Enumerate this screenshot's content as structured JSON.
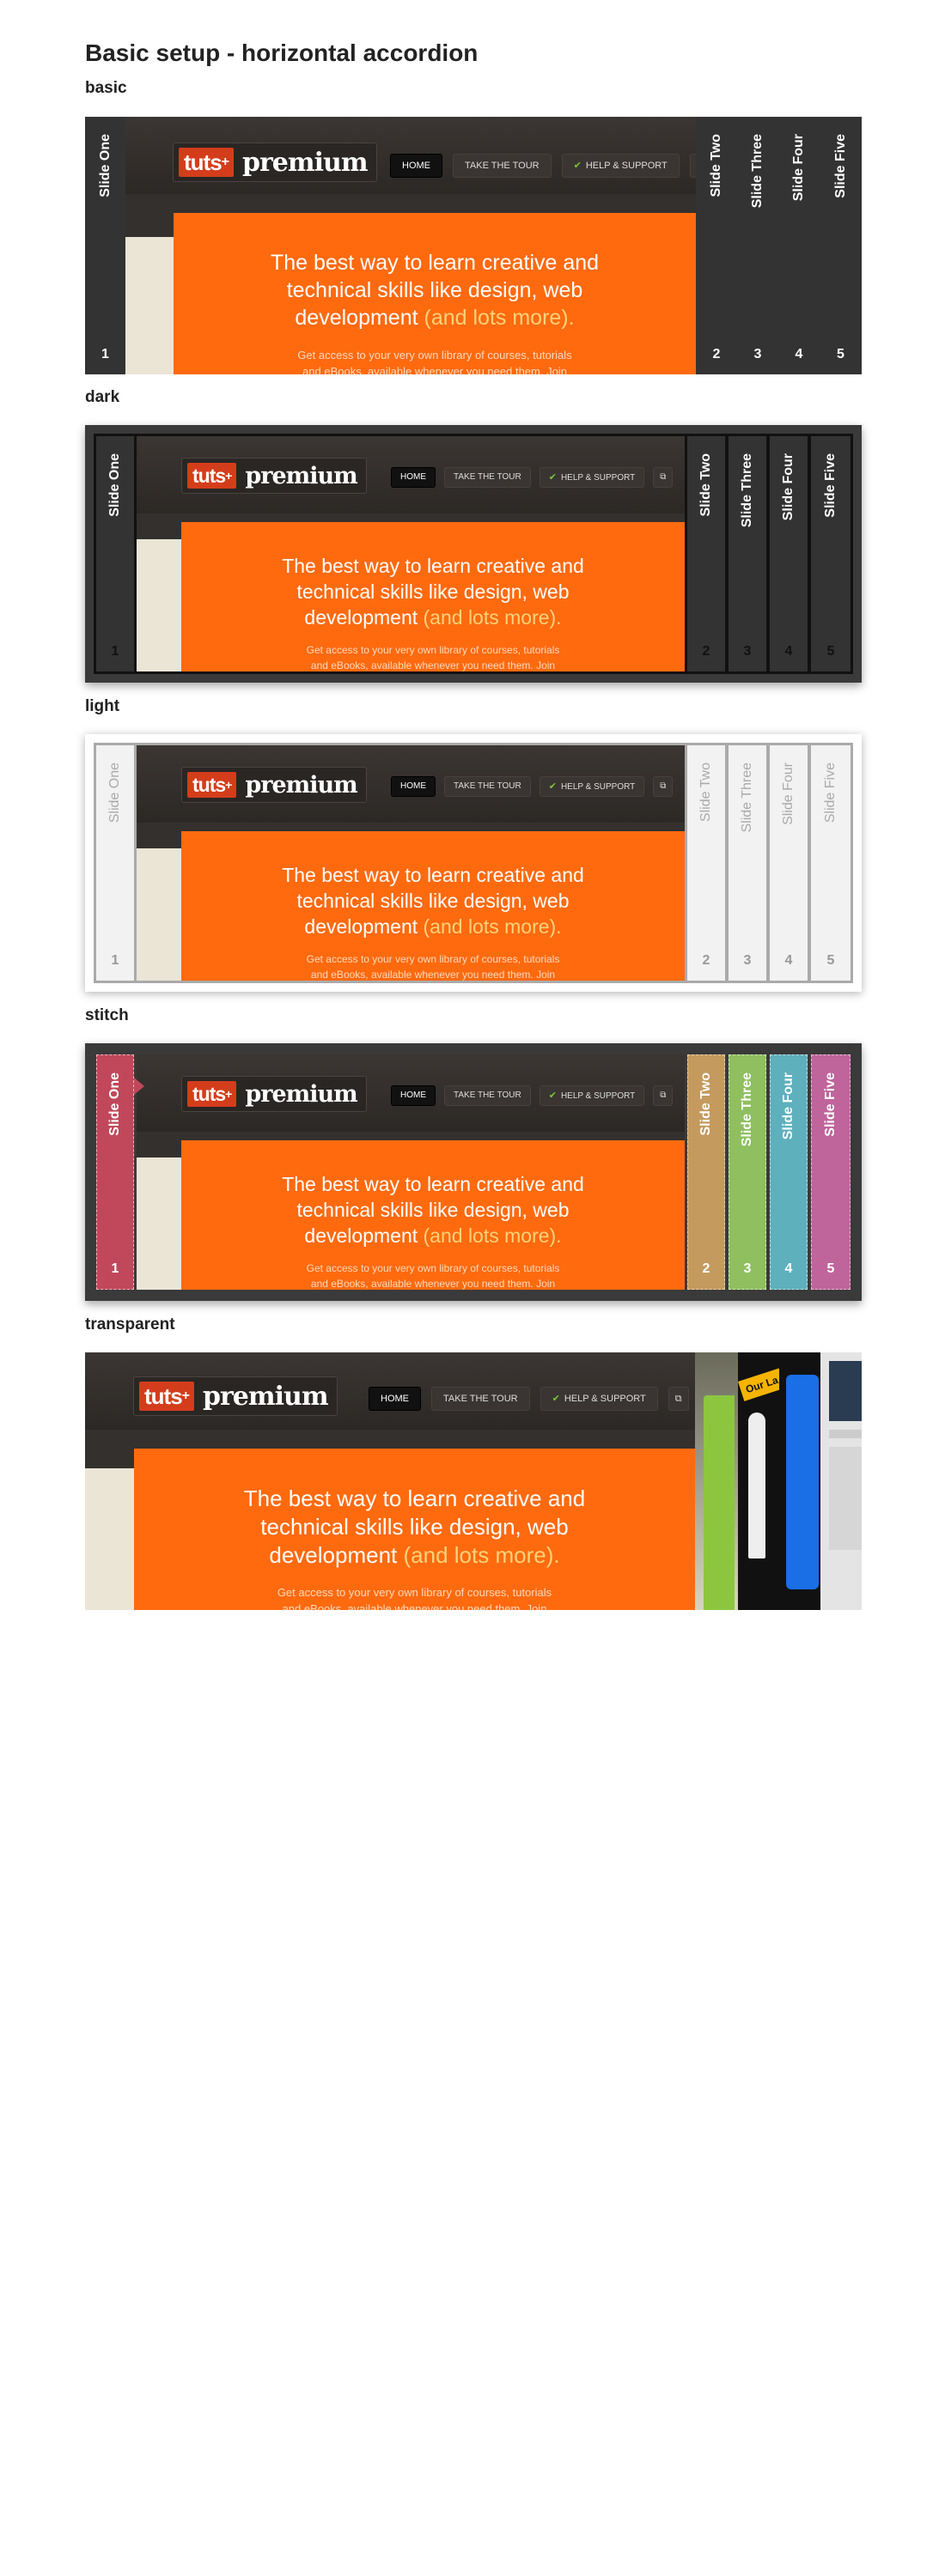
{
  "page_title": "Basic setup - horizontal accordion",
  "sections": [
    {
      "label": "basic"
    },
    {
      "label": "dark"
    },
    {
      "label": "light"
    },
    {
      "label": "stitch"
    },
    {
      "label": "transparent"
    }
  ],
  "slides": {
    "labels": [
      "Slide One",
      "Slide Two",
      "Slide Three",
      "Slide Four",
      "Slide Five"
    ],
    "numbers": [
      "1",
      "2",
      "3",
      "4",
      "5"
    ]
  },
  "content": {
    "logo_tuts": "tuts",
    "logo_plus": "+",
    "logo_premium": "premium",
    "nav": [
      "HOME",
      "TAKE THE TOUR",
      "HELP & SUPPORT"
    ],
    "hero_line1": "The best way to learn creative and",
    "hero_line2": "technical skills like design, web",
    "hero_line3": "development",
    "hero_more": "(and lots more).",
    "sub_line1": "Get access to your very own library of courses, tutorials",
    "sub_line2": "and eBooks, available whenever you need them. Join"
  },
  "transparent_card_text": "Our La",
  "icons": {
    "check": "check-icon",
    "login": "login-icon",
    "ribbon": "ribbon-icon"
  },
  "colors": {
    "orange": "#ff6a0f",
    "brand_red": "#d43d1b",
    "stitch_one": "#c0485a",
    "stitch_two": "#c49a5e",
    "stitch_three": "#8fbf5e",
    "stitch_four": "#5eb0bd",
    "stitch_five": "#c0649c"
  }
}
